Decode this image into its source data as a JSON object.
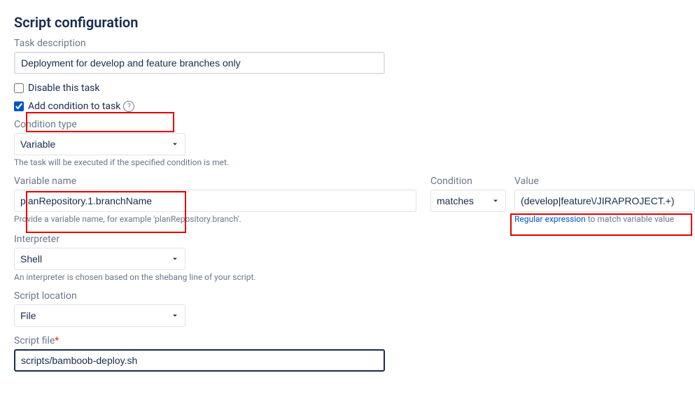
{
  "title": "Script configuration",
  "taskDescription": {
    "label": "Task description",
    "value": "Deployment for develop and feature branches only"
  },
  "disableTask": {
    "label": "Disable this task",
    "checked": false
  },
  "addCondition": {
    "label": "Add condition to task",
    "checked": true
  },
  "conditionType": {
    "label": "Condition type",
    "value": "Variable",
    "helpText": "The task will be executed if the specified condition is met."
  },
  "variableName": {
    "label": "Variable name",
    "value": "planRepository.1.branchName",
    "helpText": "Provide a variable name, for example 'planRepository.branch'."
  },
  "condition": {
    "label": "Condition",
    "value": "matches"
  },
  "value": {
    "label": "Value",
    "value": "(develop|feature\\/JIRAPROJECT.+)",
    "helpLink": "Regular expression",
    "helpSuffix": " to match variable value"
  },
  "interpreter": {
    "label": "Interpreter",
    "value": "Shell",
    "helpText": "An interpreter is chosen based on the shebang line of your script."
  },
  "scriptLocation": {
    "label": "Script location",
    "value": "File"
  },
  "scriptFile": {
    "label": "Script file",
    "value": "scripts/bamboob-deploy.sh"
  }
}
